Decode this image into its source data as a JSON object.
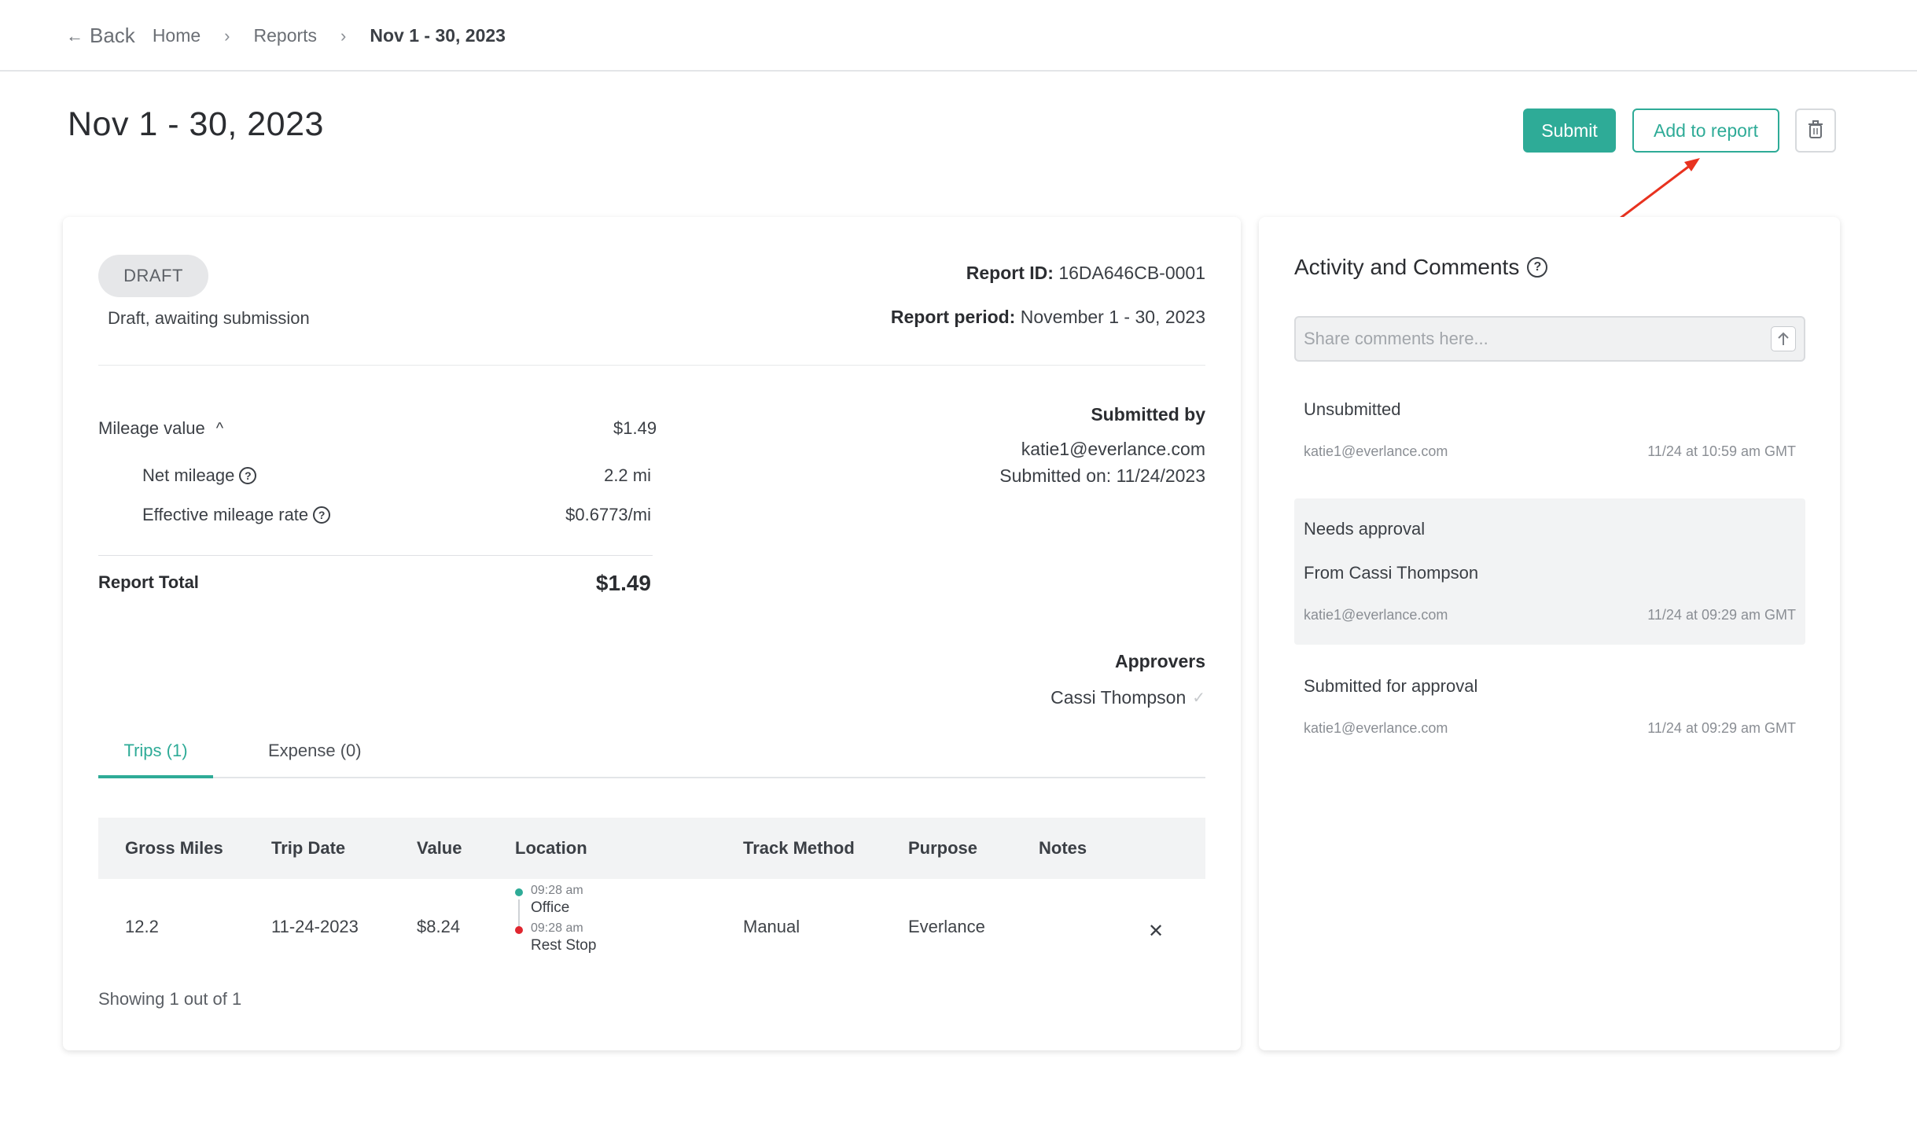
{
  "breadcrumb": {
    "back_label": "Back",
    "items": [
      "Home",
      "Reports"
    ],
    "current": "Nov 1 - 30, 2023"
  },
  "page": {
    "title": "Nov 1 - 30, 2023",
    "submit_label": "Submit",
    "add_to_report_label": "Add to report"
  },
  "report": {
    "status_badge": "DRAFT",
    "status_desc": "Draft, awaiting submission",
    "id_label": "Report ID:",
    "id_value": "16DA646CB-0001",
    "period_label": "Report period:",
    "period_value": "November 1 - 30, 2023",
    "mileage_value_label": "Mileage value",
    "mileage_value": "$1.49",
    "net_mileage_label": "Net mileage",
    "net_mileage": "2.2 mi",
    "rate_label": "Effective mileage rate",
    "rate": "$0.6773/mi",
    "total_label": "Report Total",
    "total": "$1.49",
    "submitted_by_label": "Submitted by",
    "submitted_by": "katie1@everlance.com",
    "submitted_on": "Submitted on: 11/24/2023",
    "approvers_label": "Approvers",
    "approver": "Cassi Thompson"
  },
  "tabs": [
    "Trips (1)",
    "Expense (0)"
  ],
  "table": {
    "headers": [
      "Gross Miles",
      "Trip Date",
      "Value",
      "Location",
      "Track Method",
      "Purpose",
      "Notes"
    ],
    "rows": [
      {
        "gross_miles": "12.2",
        "trip_date": "11-24-2023",
        "value": "$8.24",
        "start_time": "09:28 am",
        "start_name": "Office",
        "end_time": "09:28 am",
        "end_name": "Rest Stop",
        "track_method": "Manual",
        "purpose": "Everlance",
        "notes": ""
      }
    ],
    "footer": "Showing 1 out of 1"
  },
  "activity": {
    "title": "Activity and Comments",
    "placeholder": "Share comments here...",
    "items": [
      {
        "label": "Unsubmitted",
        "email": "katie1@everlance.com",
        "time": "11/24 at 10:59 am GMT"
      },
      {
        "label": "Needs approval",
        "sub": "From Cassi Thompson",
        "email": "katie1@everlance.com",
        "time": "11/24 at 09:29 am GMT"
      },
      {
        "label": "Submitted for approval",
        "email": "katie1@everlance.com",
        "time": "11/24 at 09:29 am GMT"
      }
    ]
  },
  "colors": {
    "accent": "#2eab97",
    "start_dot": "#2eab97",
    "end_dot": "#e0262f",
    "annotation_arrow": "#e8321f"
  },
  "icons": {
    "back": "arrow-left-icon",
    "separator": "chevron-right-icon",
    "trash": "trash-icon",
    "collapse": "chevron-up-icon",
    "help": "question-circle-icon",
    "approved": "check-icon",
    "remove": "close-icon",
    "send": "arrow-up-icon"
  }
}
